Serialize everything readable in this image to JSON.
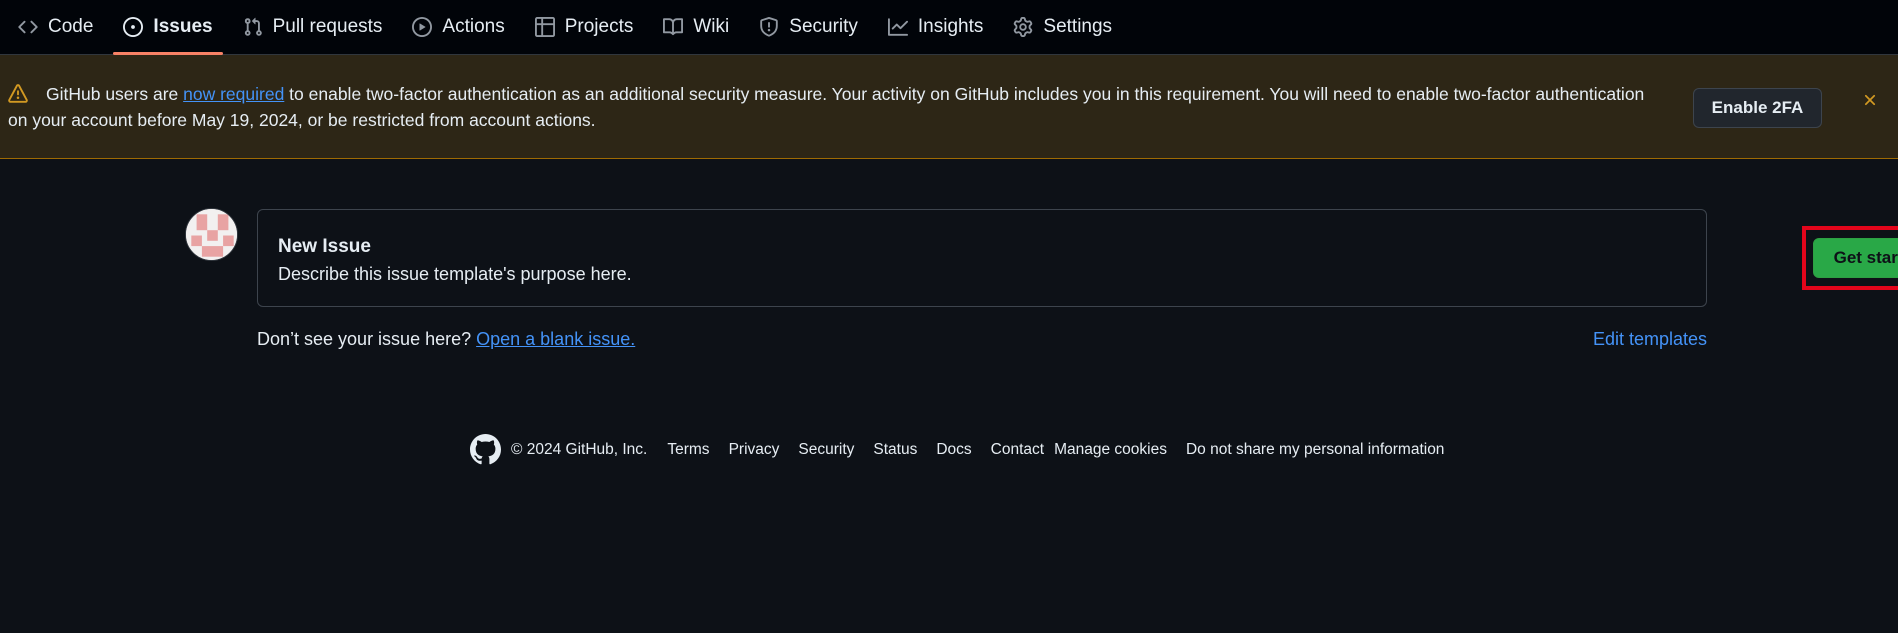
{
  "nav": {
    "tabs": [
      {
        "label": "Code",
        "icon": "code-icon",
        "active": false
      },
      {
        "label": "Issues",
        "icon": "issue-opened-icon",
        "active": true
      },
      {
        "label": "Pull requests",
        "icon": "git-pull-request-icon",
        "active": false
      },
      {
        "label": "Actions",
        "icon": "play-icon",
        "active": false
      },
      {
        "label": "Projects",
        "icon": "table-icon",
        "active": false
      },
      {
        "label": "Wiki",
        "icon": "book-icon",
        "active": false
      },
      {
        "label": "Security",
        "icon": "shield-icon",
        "active": false
      },
      {
        "label": "Insights",
        "icon": "graph-icon",
        "active": false
      },
      {
        "label": "Settings",
        "icon": "gear-icon",
        "active": false
      }
    ]
  },
  "banner": {
    "text_before": "GitHub users are ",
    "link_text": "now required",
    "text_after": " to enable two-factor authentication as an additional security measure. Your activity on GitHub includes you in this requirement. You will need to enable two-factor authentication on your account before May 19, 2024, or be restricted from account actions.",
    "button_label": "Enable 2FA",
    "close_icon": "x-icon",
    "warning_icon": "alert-icon"
  },
  "template": {
    "title": "New Issue",
    "description": "Describe this issue template's purpose here.",
    "button_label": "Get started"
  },
  "below": {
    "prompt": "Don’t see your issue here? ",
    "blank_link": "Open a blank issue.",
    "edit_link": "Edit templates"
  },
  "footer": {
    "copyright": "© 2024 GitHub, Inc.",
    "links": [
      "Terms",
      "Privacy",
      "Security",
      "Status",
      "Docs",
      "Contact",
      "Manage cookies",
      "Do not share my personal information"
    ]
  },
  "colors": {
    "background": "#0d1117",
    "banner_bg": "#2d2616",
    "accent_orange": "#f78166",
    "link_blue": "#4493f8",
    "primary_green": "#29a847",
    "highlight_red": "#e3051b"
  }
}
